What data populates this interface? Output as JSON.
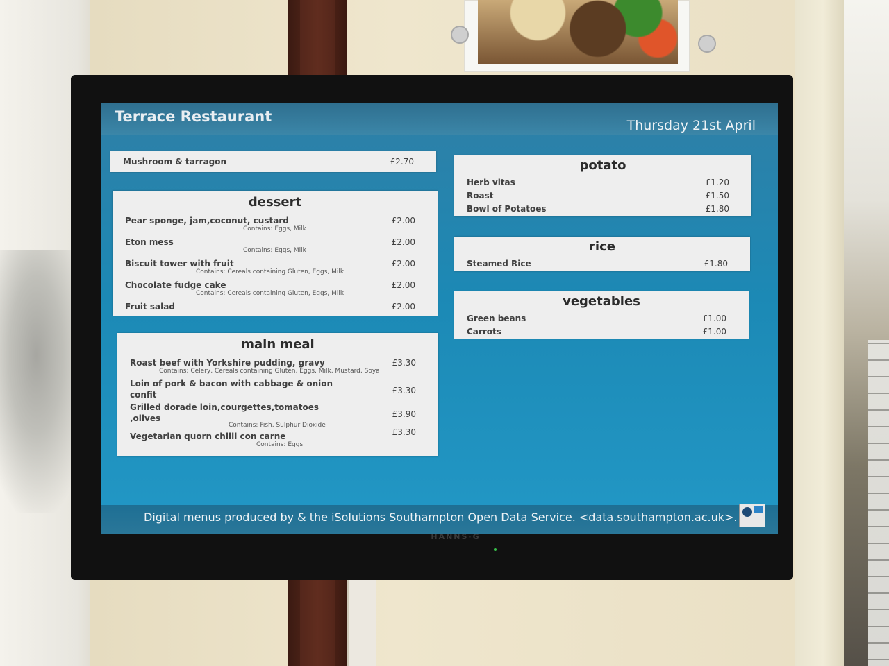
{
  "signage": {
    "title": "Terrace Restaurant",
    "date": "Thursday 21st April",
    "footer": "Digital menus produced by & the iSolutions Southampton Open Data Service. <data.southampton.ac.uk>.",
    "monitor_brand": "HANNS·G"
  },
  "soup": {
    "items": [
      {
        "name": "Mushroom & tarragon",
        "price": "£2.70"
      }
    ]
  },
  "dessert": {
    "heading": "dessert",
    "items": [
      {
        "name": "Pear sponge, jam,coconut, custard",
        "allergens": "Contains: Eggs, Milk",
        "price": "£2.00"
      },
      {
        "name": "Eton mess",
        "allergens": "Contains: Eggs, Milk",
        "price": "£2.00"
      },
      {
        "name": "Biscuit tower with fruit",
        "allergens": "Contains: Cereals containing Gluten, Eggs, Milk",
        "price": "£2.00"
      },
      {
        "name": "Chocolate fudge cake",
        "allergens": "Contains: Cereals containing Gluten, Eggs, Milk",
        "price": "£2.00"
      },
      {
        "name": "Fruit salad",
        "price": "£2.00"
      }
    ]
  },
  "main_meal": {
    "heading": "main meal",
    "items": [
      {
        "name": "Roast beef with Yorkshire pudding, gravy",
        "allergens": "Contains: Celery, Cereals containing Gluten, Eggs, Milk, Mustard, Soya",
        "price": "£3.30"
      },
      {
        "name": "Loin of pork & bacon with cabbage & onion",
        "name2": "confit",
        "price": "£3.30"
      },
      {
        "name": "Grilled dorade loin,courgettes,tomatoes",
        "name2": ",olives",
        "allergens": "Contains: Fish, Sulphur Dioxide",
        "price": "£3.90"
      },
      {
        "name": "Vegetarian quorn chilli con carne",
        "allergens": "Contains: Eggs",
        "price": "£3.30"
      }
    ]
  },
  "potato": {
    "heading": "potato",
    "items": [
      {
        "name": "Herb vitas",
        "price": "£1.20"
      },
      {
        "name": "Roast",
        "price": "£1.50"
      },
      {
        "name": "Bowl of Potatoes",
        "price": "£1.80"
      }
    ]
  },
  "rice": {
    "heading": "rice",
    "items": [
      {
        "name": "Steamed Rice",
        "price": "£1.80"
      }
    ]
  },
  "vegetables": {
    "heading": "vegetables",
    "items": [
      {
        "name": "Green beans",
        "price": "£1.00"
      },
      {
        "name": "Carrots",
        "price": "£1.00"
      }
    ]
  }
}
